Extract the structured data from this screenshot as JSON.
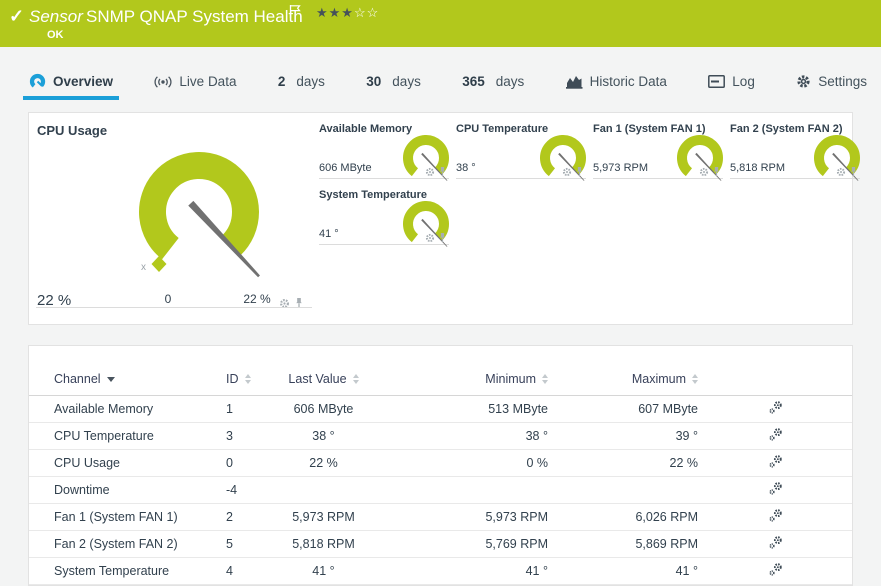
{
  "colors": {
    "green": "#b2c81c",
    "blue": "#1b9fd8",
    "text_dark": "#32414e"
  },
  "header": {
    "kind": "Sensor",
    "title": "SNMP QNAP System Health",
    "status": "OK",
    "stars_filled": "★★★",
    "stars_empty": "☆☆"
  },
  "tabs": [
    {
      "label": "Overview"
    },
    {
      "label": "Live Data"
    },
    {
      "num": "2",
      "label": "days"
    },
    {
      "num": "30",
      "label": "days"
    },
    {
      "num": "365",
      "label": "days"
    },
    {
      "label": "Historic Data"
    },
    {
      "label": "Log"
    },
    {
      "label": "Settings"
    }
  ],
  "gauges": {
    "main": {
      "title": "CPU Usage",
      "value": "22 %",
      "scale_min": "0",
      "scale_max": "22 %",
      "axis_toggle": "x"
    },
    "minis": [
      {
        "title": "Available Memory",
        "value": "606 MByte"
      },
      {
        "title": "CPU Temperature",
        "value": "38 °"
      },
      {
        "title": "Fan 1 (System FAN 1)",
        "value": "5,973 RPM"
      },
      {
        "title": "Fan 2 (System FAN 2)",
        "value": "5,818 RPM"
      },
      {
        "title": "System Temperature",
        "value": "41 °"
      }
    ]
  },
  "table": {
    "headers": {
      "channel": "Channel",
      "id": "ID",
      "last": "Last Value",
      "min": "Minimum",
      "max": "Maximum"
    },
    "rows": [
      {
        "channel": "Available Memory",
        "id": "1",
        "last": "606 MByte",
        "min": "513 MByte",
        "max": "607 MByte"
      },
      {
        "channel": "CPU Temperature",
        "id": "3",
        "last": "38 °",
        "min": "38 °",
        "max": "39 °"
      },
      {
        "channel": "CPU Usage",
        "id": "0",
        "last": "22 %",
        "min": "0 %",
        "max": "22 %"
      },
      {
        "channel": "Downtime",
        "id": "-4",
        "last": "",
        "min": "",
        "max": ""
      },
      {
        "channel": "Fan 1 (System FAN 1)",
        "id": "2",
        "last": "5,973 RPM",
        "min": "5,973 RPM",
        "max": "6,026 RPM"
      },
      {
        "channel": "Fan 2 (System FAN 2)",
        "id": "5",
        "last": "5,818 RPM",
        "min": "5,769 RPM",
        "max": "5,869 RPM"
      },
      {
        "channel": "System Temperature",
        "id": "4",
        "last": "41 °",
        "min": "41 °",
        "max": "41 °"
      }
    ]
  }
}
